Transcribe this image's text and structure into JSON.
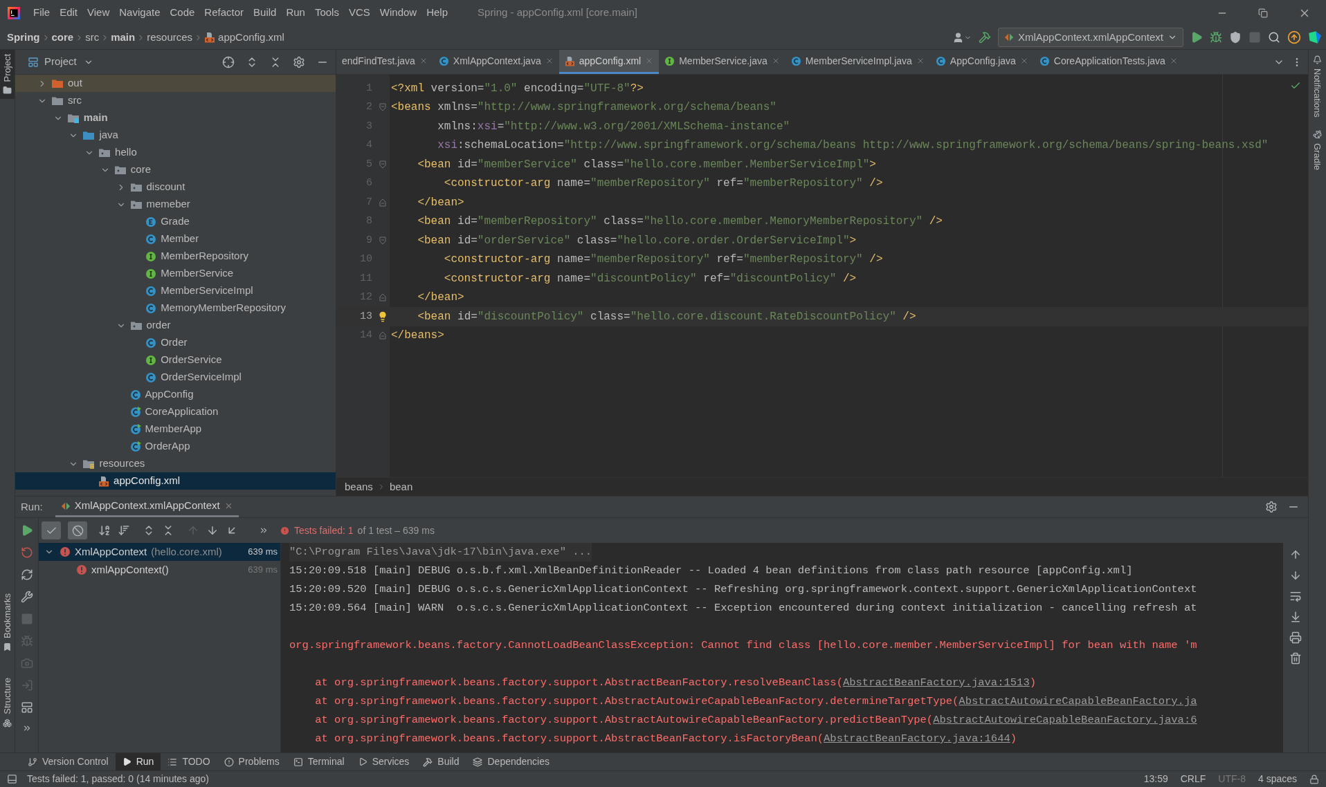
{
  "menu": [
    "File",
    "Edit",
    "View",
    "Navigate",
    "Code",
    "Refactor",
    "Build",
    "Run",
    "Tools",
    "VCS",
    "Window",
    "Help"
  ],
  "window_title": "Spring - appConfig.xml [core.main]",
  "breadcrumbs": [
    {
      "label": "Spring",
      "bold": true,
      "kind": "text"
    },
    {
      "label": "core",
      "bold": true,
      "kind": "text"
    },
    {
      "label": "src",
      "bold": false,
      "kind": "text"
    },
    {
      "label": "main",
      "bold": true,
      "kind": "text"
    },
    {
      "label": "resources",
      "bold": false,
      "kind": "text"
    },
    {
      "label": "appConfig.xml",
      "bold": false,
      "kind": "xml"
    }
  ],
  "run_config": "XmlAppContext.xmlAppContext",
  "actions": [
    {
      "kind": "run",
      "disabled": false
    },
    {
      "kind": "debug",
      "disabled": false
    },
    {
      "kind": "coverage",
      "disabled": false
    },
    {
      "kind": "stop",
      "disabled": true
    }
  ],
  "left_stripe": [
    {
      "label": "Project",
      "selected": true
    },
    {
      "label": "Bookmarks",
      "selected": false
    },
    {
      "label": "Structure",
      "selected": false
    }
  ],
  "right_stripe": [
    {
      "label": "Notifications",
      "kind": "bell"
    },
    {
      "label": "Gradle",
      "kind": "elephant"
    }
  ],
  "project": {
    "title": "Project",
    "tree": [
      {
        "label": "out",
        "kind": "excluded",
        "expanded": false,
        "selected": false
      },
      {
        "label": "src",
        "kind": "folder",
        "expanded": true,
        "selected": false,
        "children": [
          {
            "label": "main",
            "kind": "module",
            "expanded": true,
            "selected": false,
            "children": [
              {
                "label": "java",
                "kind": "source",
                "expanded": true,
                "selected": false,
                "children": [
                  {
                    "label": "hello",
                    "kind": "package",
                    "expanded": true,
                    "selected": false,
                    "children": [
                      {
                        "label": "core",
                        "kind": "package",
                        "expanded": true,
                        "selected": false,
                        "children": [
                          {
                            "label": "discount",
                            "kind": "package",
                            "expanded": false,
                            "selected": false
                          },
                          {
                            "label": "memeber",
                            "kind": "package",
                            "expanded": true,
                            "selected": false,
                            "children": [
                              {
                                "label": "Grade",
                                "kind": "enum",
                                "selected": false
                              },
                              {
                                "label": "Member",
                                "kind": "class",
                                "selected": false
                              },
                              {
                                "label": "MemberRepository",
                                "kind": "interface",
                                "selected": false
                              },
                              {
                                "label": "MemberService",
                                "kind": "interface",
                                "selected": false
                              },
                              {
                                "label": "MemberServiceImpl",
                                "kind": "class",
                                "selected": false
                              },
                              {
                                "label": "MemoryMemberRepository",
                                "kind": "class",
                                "selected": false
                              }
                            ]
                          },
                          {
                            "label": "order",
                            "kind": "package",
                            "expanded": true,
                            "selected": false,
                            "children": [
                              {
                                "label": "Order",
                                "kind": "class",
                                "selected": false
                              },
                              {
                                "label": "OrderService",
                                "kind": "interface",
                                "selected": false
                              },
                              {
                                "label": "OrderServiceImpl",
                                "kind": "class",
                                "selected": false
                              }
                            ]
                          },
                          {
                            "label": "AppConfig",
                            "kind": "class",
                            "selected": false
                          },
                          {
                            "label": "CoreApplication",
                            "kind": "main",
                            "selected": false
                          },
                          {
                            "label": "MemberApp",
                            "kind": "main",
                            "selected": false
                          },
                          {
                            "label": "OrderApp",
                            "kind": "main",
                            "selected": false
                          }
                        ]
                      }
                    ]
                  }
                ]
              },
              {
                "label": "resources",
                "kind": "resources",
                "expanded": true,
                "selected": false,
                "children": [
                  {
                    "label": "appConfig.xml",
                    "kind": "xml",
                    "selected": true
                  }
                ]
              }
            ]
          }
        ]
      }
    ]
  },
  "editor": {
    "tabs": [
      {
        "label": "endFindTest.java",
        "selected": false
      },
      {
        "label": "XmlAppContext.java",
        "kind": "class",
        "selected": false
      },
      {
        "label": "appConfig.xml",
        "kind": "xml",
        "selected": true
      },
      {
        "label": "MemberService.java",
        "kind": "interface",
        "selected": false
      },
      {
        "label": "MemberServiceImpl.java",
        "kind": "class",
        "selected": false
      },
      {
        "label": "AppConfig.java",
        "kind": "class",
        "selected": false
      },
      {
        "label": "CoreApplicationTests.java",
        "kind": "class",
        "selected": false
      }
    ],
    "lines": [
      {
        "number": "1",
        "current": false,
        "tokens": [
          {
            "kind": "tag",
            "t": "<?xml"
          },
          {
            "kind": "attr",
            "t": " version="
          },
          {
            "kind": "val",
            "t": "\"1.0\""
          },
          {
            "kind": "attr",
            "t": " encoding="
          },
          {
            "kind": "val",
            "t": "\"UTF-8\""
          },
          {
            "kind": "tag",
            "t": "?>"
          }
        ]
      },
      {
        "number": "2",
        "current": false,
        "fold_start": true,
        "tokens": [
          {
            "kind": "tag",
            "t": "<beans"
          },
          {
            "kind": "attr",
            "t": " xmlns="
          },
          {
            "kind": "val",
            "t": "\"http://www.springframework.org/schema/beans\""
          }
        ]
      },
      {
        "number": "3",
        "current": false,
        "tokens": [
          {
            "kind": "attr",
            "t": "       xmlns:"
          },
          {
            "kind": "ns",
            "t": "xsi"
          },
          {
            "kind": "attr",
            "t": "="
          },
          {
            "kind": "val",
            "t": "\"http://www.w3.org/2001/XMLSchema-instance\""
          }
        ]
      },
      {
        "number": "4",
        "current": false,
        "tokens": [
          {
            "kind": "ns",
            "t": "       xsi"
          },
          {
            "kind": "attr",
            "t": ":schemaLocation="
          },
          {
            "kind": "val",
            "t": "\"http://www.springframework.org/schema/beans http://www.springframework.org/schema/beans/spring-beans.xsd\""
          }
        ]
      },
      {
        "number": "5",
        "current": false,
        "fold_start": true,
        "tokens": [
          {
            "kind": "tag",
            "t": "    <bean"
          },
          {
            "kind": "attr",
            "t": " id="
          },
          {
            "kind": "val",
            "t": "\"memberService\""
          },
          {
            "kind": "attr",
            "t": " class="
          },
          {
            "kind": "val",
            "t": "\"hello.core.member.MemberServiceImpl\""
          },
          {
            "kind": "tag",
            "t": ">"
          }
        ]
      },
      {
        "number": "6",
        "current": false,
        "tokens": [
          {
            "kind": "tag",
            "t": "        <constructor-arg"
          },
          {
            "kind": "attr",
            "t": " name="
          },
          {
            "kind": "val",
            "t": "\"memberRepository\""
          },
          {
            "kind": "attr",
            "t": " ref="
          },
          {
            "kind": "val",
            "t": "\"memberRepository\""
          },
          {
            "kind": "tag",
            "t": " />"
          }
        ]
      },
      {
        "number": "7",
        "current": false,
        "fold_end": true,
        "tokens": [
          {
            "kind": "tag",
            "t": "    </bean>"
          }
        ]
      },
      {
        "number": "8",
        "current": false,
        "tokens": [
          {
            "kind": "tag",
            "t": "    <bean"
          },
          {
            "kind": "attr",
            "t": " id="
          },
          {
            "kind": "val",
            "t": "\"memberRepository\""
          },
          {
            "kind": "attr",
            "t": " class="
          },
          {
            "kind": "val",
            "t": "\"hello.core.member.MemoryMemberRepository\""
          },
          {
            "kind": "tag",
            "t": " />"
          }
        ]
      },
      {
        "number": "9",
        "current": false,
        "fold_start": true,
        "tokens": [
          {
            "kind": "tag",
            "t": "    <bean"
          },
          {
            "kind": "attr",
            "t": " id="
          },
          {
            "kind": "val",
            "t": "\"orderService\""
          },
          {
            "kind": "attr",
            "t": " class="
          },
          {
            "kind": "val",
            "t": "\"hello.core.order.OrderServiceImpl\""
          },
          {
            "kind": "tag",
            "t": ">"
          }
        ]
      },
      {
        "number": "10",
        "current": false,
        "tokens": [
          {
            "kind": "tag",
            "t": "        <constructor-arg"
          },
          {
            "kind": "attr",
            "t": " name="
          },
          {
            "kind": "val",
            "t": "\"memberRepository\""
          },
          {
            "kind": "attr",
            "t": " ref="
          },
          {
            "kind": "val",
            "t": "\"memberRepository\""
          },
          {
            "kind": "tag",
            "t": " />"
          }
        ]
      },
      {
        "number": "11",
        "current": false,
        "tokens": [
          {
            "kind": "tag",
            "t": "        <constructor-arg"
          },
          {
            "kind": "attr",
            "t": " name="
          },
          {
            "kind": "val",
            "t": "\"discountPolicy\""
          },
          {
            "kind": "attr",
            "t": " ref="
          },
          {
            "kind": "val",
            "t": "\"discountPolicy\""
          },
          {
            "kind": "tag",
            "t": " />"
          }
        ]
      },
      {
        "number": "12",
        "current": false,
        "fold_end": true,
        "tokens": [
          {
            "kind": "tag",
            "t": "    </bean>"
          }
        ]
      },
      {
        "number": "13",
        "current": true,
        "bulb": true,
        "tokens": [
          {
            "kind": "tag",
            "t": "    <bean"
          },
          {
            "kind": "attr",
            "t": " id="
          },
          {
            "kind": "val",
            "t": "\"discountPolicy\""
          },
          {
            "kind": "attr",
            "t": " class="
          },
          {
            "kind": "val",
            "t": "\"hello.core.discount.RateDiscountPolicy\""
          },
          {
            "kind": "tag",
            "t": " />"
          }
        ]
      },
      {
        "number": "14",
        "current": false,
        "fold_end": true,
        "tokens": [
          {
            "kind": "tag",
            "t": "</beans>"
          }
        ]
      }
    ],
    "path": [
      "beans",
      "bean"
    ]
  },
  "run": {
    "label": "Run:",
    "tab": "XmlAppContext.xmlAppContext",
    "toggles": [
      {
        "kind": "passed",
        "on": true
      },
      {
        "kind": "ignored",
        "on": true
      }
    ],
    "side_actions": [
      {
        "kind": "rerun",
        "disabled": false
      },
      {
        "kind": "rerun-failed",
        "disabled": false
      },
      {
        "kind": "auto",
        "disabled": false
      },
      {
        "kind": "settings",
        "disabled": false
      },
      {
        "kind": "stop",
        "disabled": true
      },
      {
        "kind": "dump",
        "disabled": true
      },
      {
        "kind": "snapshot",
        "disabled": true
      },
      {
        "kind": "exit",
        "disabled": true
      },
      {
        "kind": "layout",
        "disabled": false
      }
    ],
    "status_failed": "Tests failed: 1",
    "status_detail": "of 1 test – 639 ms",
    "tests": [
      {
        "name": "XmlAppContext",
        "detail": "(hello.core.xml)",
        "time": "639 ms",
        "kind": "failed",
        "expanded": true,
        "selected": true,
        "children": [
          {
            "name": "xmlAppContext()",
            "time": "639 ms",
            "kind": "failed",
            "selected": false
          }
        ]
      }
    ],
    "console": [
      {
        "kind": "command",
        "text": "\"C:\\Program Files\\Java\\jdk-17\\bin\\java.exe\" ..."
      },
      {
        "kind": "log",
        "text": "15:20:09.518 [main] DEBUG o.s.b.f.xml.XmlBeanDefinitionReader -- Loaded 4 bean definitions from class path resource [appConfig.xml]"
      },
      {
        "kind": "log",
        "text": "15:20:09.520 [main] DEBUG o.s.c.s.GenericXmlApplicationContext -- Refreshing org.springframework.context.support.GenericXmlApplicationContext"
      },
      {
        "kind": "log",
        "text": "15:20:09.564 [main] WARN  o.s.c.s.GenericXmlApplicationContext -- Exception encountered during context initialization - cancelling refresh at"
      },
      {
        "kind": "error",
        "text": "org.springframework.beans.factory.CannotLoadBeanClassException: Cannot find class [hello.core.member.MemberServiceImpl] for bean with name 'm"
      },
      {
        "kind": "stack",
        "text": "    at org.springframework.beans.factory.support.AbstractBeanFactory.resolveBeanClass(",
        "link": "AbstractBeanFactory.java:1513",
        "suffix": ")"
      },
      {
        "kind": "stack",
        "text": "    at org.springframework.beans.factory.support.AbstractAutowireCapableBeanFactory.determineTargetType(",
        "link": "AbstractAutowireCapableBeanFactory.ja"
      },
      {
        "kind": "stack",
        "text": "    at org.springframework.beans.factory.support.AbstractAutowireCapableBeanFactory.predictBeanType(",
        "link": "AbstractAutowireCapableBeanFactory.java:6"
      },
      {
        "kind": "stack",
        "text": "    at org.springframework.beans.factory.support.AbstractBeanFactory.isFactoryBean(",
        "link": "AbstractBeanFactory.java:1644",
        "suffix": ")"
      }
    ]
  },
  "tool_tabs": [
    {
      "label": "Version Control",
      "kind": "vcs",
      "selected": false
    },
    {
      "label": "Run",
      "kind": "run",
      "selected": true
    },
    {
      "label": "TODO",
      "kind": "todo",
      "selected": false
    },
    {
      "label": "Problems",
      "kind": "problems",
      "selected": false
    },
    {
      "label": "Terminal",
      "kind": "terminal",
      "selected": false
    },
    {
      "label": "Services",
      "kind": "services",
      "selected": false
    },
    {
      "label": "Build",
      "kind": "build",
      "selected": false
    },
    {
      "label": "Dependencies",
      "kind": "dependencies",
      "selected": false
    }
  ],
  "status": {
    "message": "Tests failed: 1, passed: 0 (14 minutes ago)",
    "items": [
      {
        "label": "13:59",
        "disabled": false
      },
      {
        "label": "CRLF",
        "disabled": false
      },
      {
        "label": "UTF-8",
        "disabled": true
      },
      {
        "label": "4 spaces",
        "disabled": false
      }
    ]
  }
}
